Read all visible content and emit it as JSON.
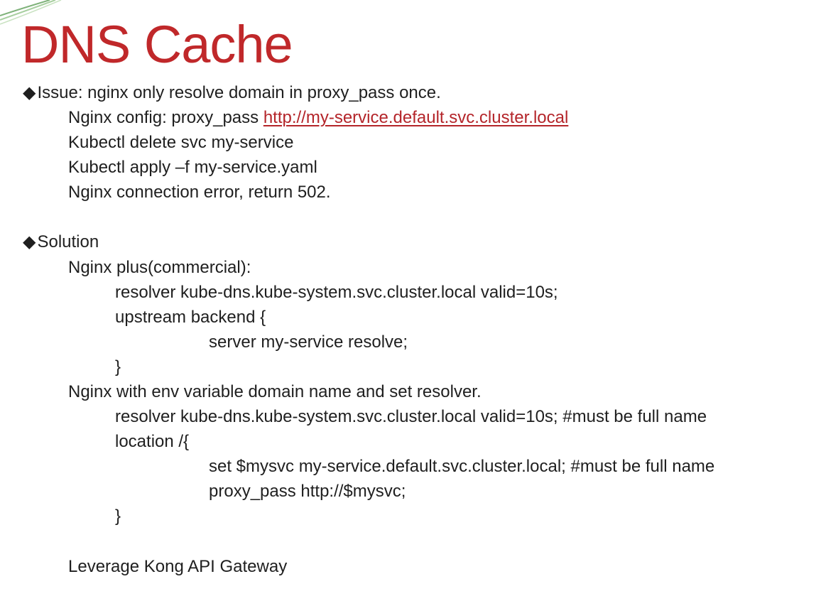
{
  "title": "DNS Cache",
  "bullet_glyph": "◆",
  "issue": {
    "heading": "Issue: nginx only resolve domain in proxy_pass once.",
    "config_prefix": "Nginx config: proxy_pass ",
    "config_link": "http://my-service.default.svc.cluster.local",
    "lines": [
      "Kubectl delete svc my-service",
      "Kubectl apply –f my-service.yaml",
      "Nginx connection error, return 502."
    ]
  },
  "solution": {
    "heading": "Solution",
    "plus_heading": "Nginx plus(commercial):",
    "plus_resolver": "resolver kube-dns.kube-system.svc.cluster.local valid=10s;",
    "plus_upstream": "upstream backend {",
    "plus_server": "server my-service resolve;",
    "plus_close": "}",
    "env_heading": "Nginx with env variable domain name and set resolver.",
    "env_resolver": "resolver kube-dns.kube-system.svc.cluster.local valid=10s; #must be full name",
    "env_location": "location /{",
    "env_set": "set $mysvc my-service.default.svc.cluster.local; #must be full name",
    "env_proxy": "proxy_pass http://$mysvc;",
    "env_close": "}",
    "kong": "Leverage Kong API Gateway"
  },
  "colors": {
    "title": "#c0282a",
    "link": "#b4252a",
    "text": "#1f1f1f"
  }
}
